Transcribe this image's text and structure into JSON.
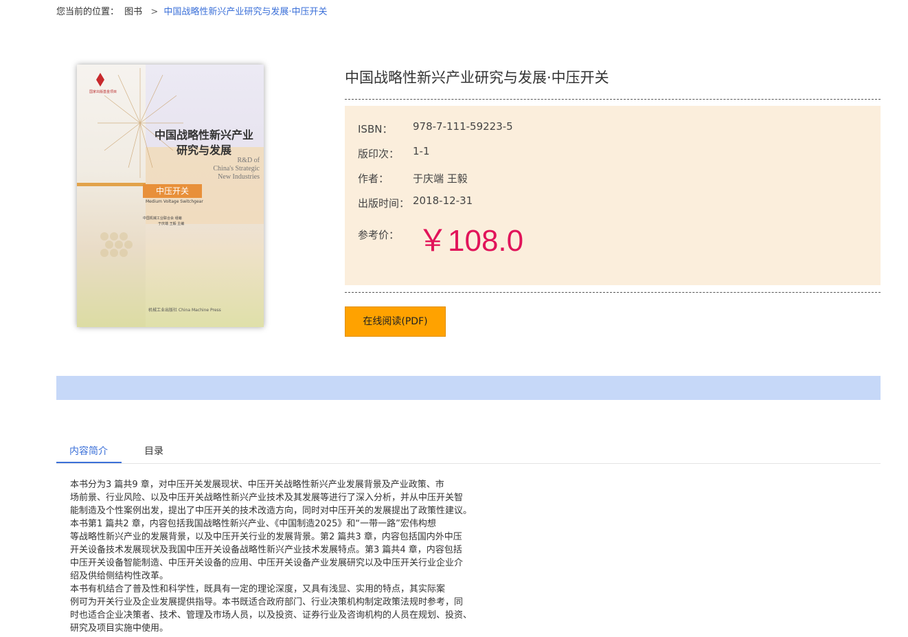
{
  "breadcrumb": {
    "prefix": "您当前的位置：",
    "link": "图书",
    "separator": ">",
    "current": "中国战略性新兴产业研究与发展·中压开关"
  },
  "cover": {
    "series_text": "国家出版基金项目",
    "title_line1": "中国战略性新兴产业",
    "title_line2": "研究与发展",
    "title_en_1": "R&D of",
    "title_en_2": "China's Strategic",
    "title_en_3": "New Industries",
    "subtitle": "中压开关",
    "subtitle_en": "Medium Voltage Switchgear",
    "compiler": "中国机械工业联合会 组编",
    "authors": "于庆端 王毅 主编",
    "press": "机械工业出版社 China Machine Press"
  },
  "book": {
    "title": "中国战略性新兴产业研究与发展·中压开关",
    "isbn_label": "ISBN：",
    "isbn": "978-7-111-59223-5",
    "edition_label": "版印次：",
    "edition": "1-1",
    "author_label": "作者：",
    "author": "于庆端 王毅",
    "date_label": "出版时间：",
    "date": "2018-12-31",
    "price_label": "参考价：",
    "price": "￥108.0"
  },
  "actions": {
    "read_online": "在线阅读(PDF)"
  },
  "tabs": [
    {
      "label": "内容简介",
      "active": true
    },
    {
      "label": "目录",
      "active": false
    }
  ],
  "description": [
    "本书分为3 篇共9 章，对中压开关发展现状、中压开关战略性新兴产业发展背景及产业政策、市",
    "场前景、行业风险、以及中压开关战略性新兴产业技术及其发展等进行了深入分析，并从中压开关智",
    "能制造及个性案例出发，提出了中压开关的技术改造方向，同时对中压开关的发展提出了政策性建议。",
    "本书第1 篇共2 章，内容包括我国战略性新兴产业、《中国制造2025》和“一带一路”宏伟构想",
    "等战略性新兴产业的发展背景，以及中压开关行业的发展背景。第2 篇共3 章，内容包括国内外中压",
    "开关设备技术发展现状及我国中压开关设备战略性新兴产业技术发展特点。第3 篇共4 章，内容包括",
    "中压开关设备智能制造、中压开关设备的应用、中压开关设备产业发展研究以及中压开关行业企业介",
    "绍及供给侧结构性改革。",
    "本书有机结合了普及性和科学性，既具有一定的理论深度，又具有浅显、实用的特点，其实际案",
    "例可为开关行业及企业发展提供指导。本书既适合政府部门、行业决策机构制定政策法规时参考，同",
    "时也适合企业决策者、技术、管理及市场人员，以及投资、证券行业及咨询机构的人员在规划、投资、",
    "研究及项目实施中使用。"
  ],
  "colors": {
    "accent_blue": "#3a6fd8",
    "price_red": "#e1145a",
    "button_orange": "#ffa200",
    "info_bg": "#fbeedc",
    "bar_blue": "#c6d8f8"
  }
}
